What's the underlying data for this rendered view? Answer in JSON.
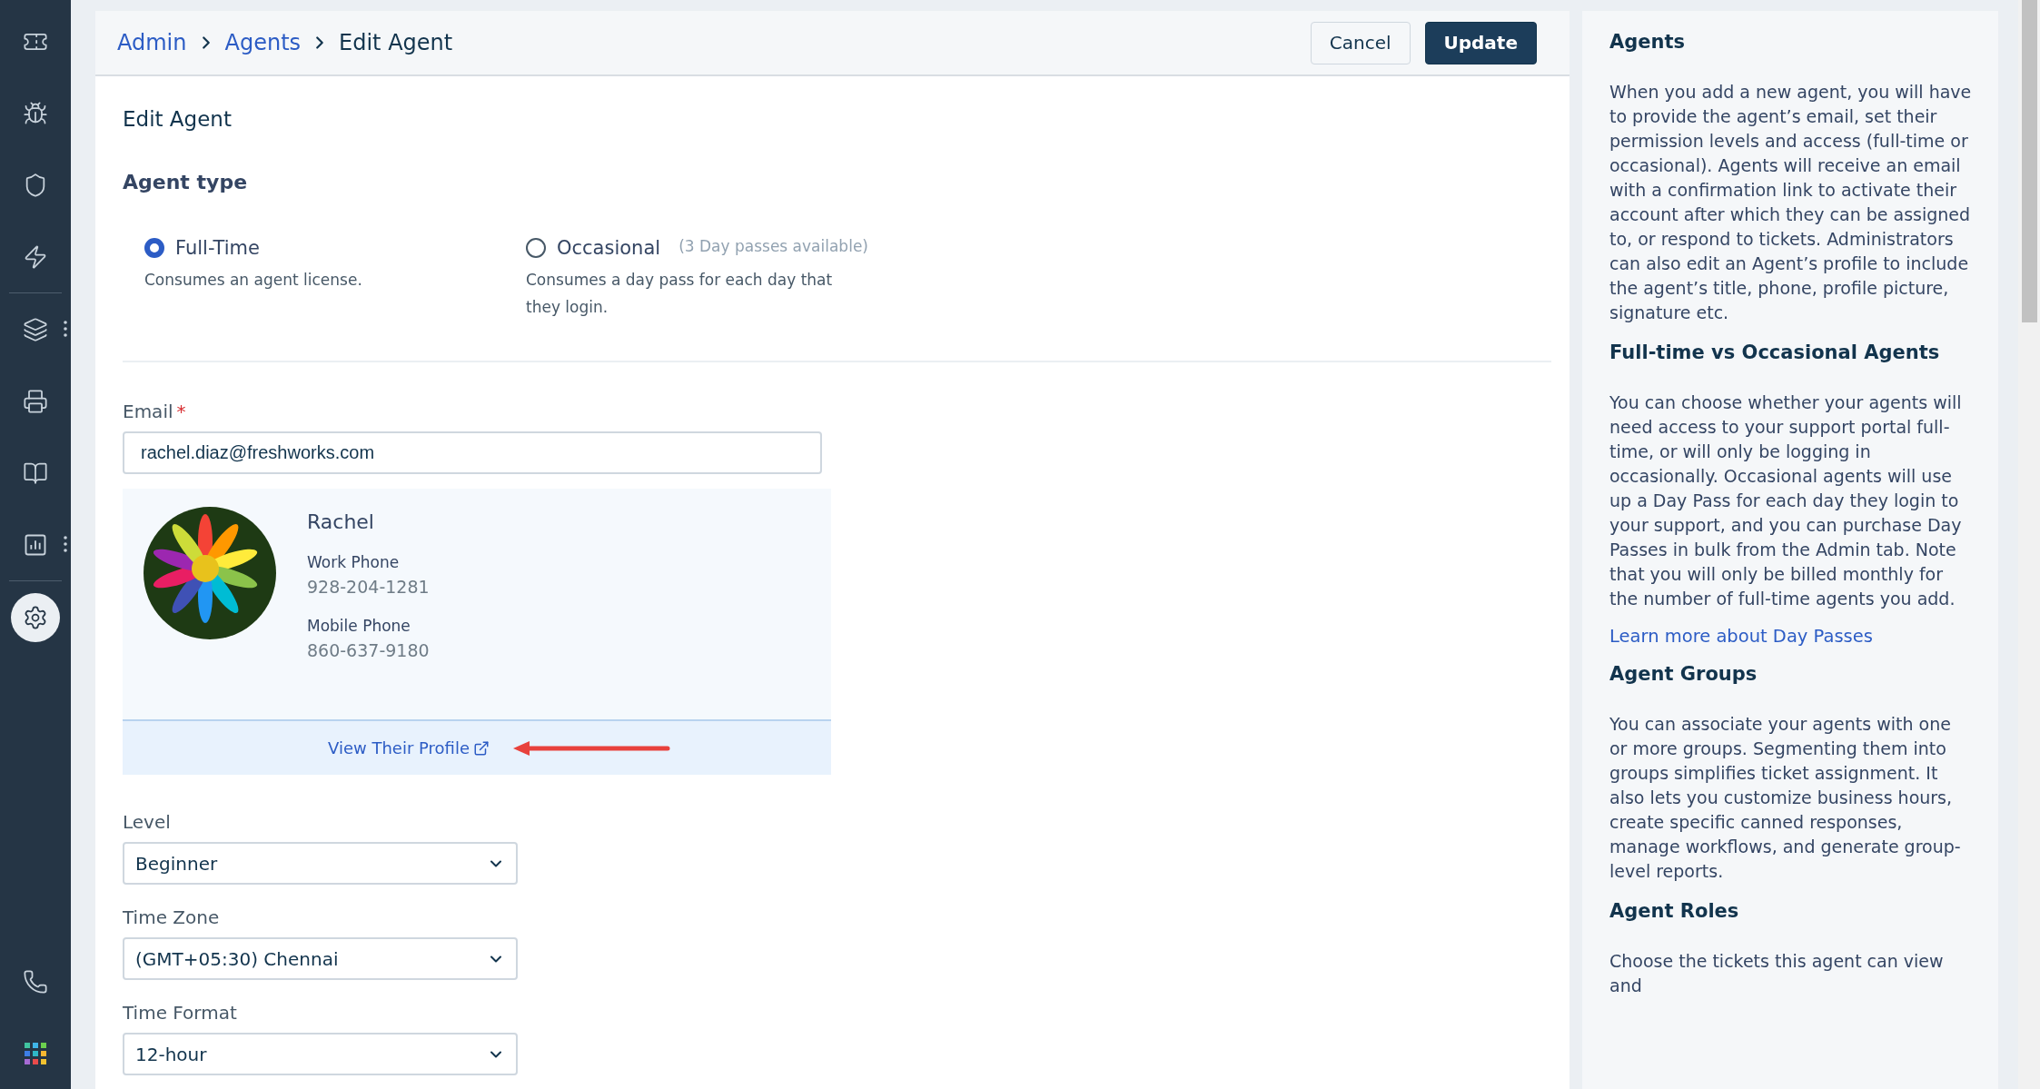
{
  "sidebar": {
    "items": [
      {
        "selected": false,
        "more": false
      },
      {
        "selected": false,
        "more": false
      },
      {
        "selected": false,
        "more": false
      },
      {
        "selected": false,
        "more": false
      },
      {
        "selected": false,
        "more": true
      },
      {
        "selected": false,
        "more": false
      },
      {
        "selected": false,
        "more": false
      },
      {
        "selected": false,
        "more": true
      },
      {
        "selected": true,
        "more": false
      }
    ]
  },
  "breadcrumb": [
    {
      "label": "Admin",
      "kind": "link"
    },
    {
      "label": "Agents",
      "kind": "link"
    },
    {
      "label": "Edit Agent",
      "kind": "current"
    }
  ],
  "actions": [
    {
      "label": "Cancel",
      "kind": "secondary"
    },
    {
      "label": "Update",
      "kind": "primary"
    }
  ],
  "form": {
    "title": "Edit Agent",
    "agent_type": {
      "label": "Agent type",
      "options": [
        {
          "label": "Full-Time",
          "description": "Consumes an agent license.",
          "selected": true
        },
        {
          "label": "Occasional",
          "hint": "(3 Day passes available)",
          "description": "Consumes a day pass for each day that they login.",
          "selected": false
        }
      ]
    },
    "email": {
      "label": "Email",
      "required_mark": "*",
      "value": "rachel.diaz@freshworks.com"
    },
    "profile": {
      "name": "Rachel",
      "fields": [
        {
          "label": "Work Phone",
          "value": "928-204-1281"
        },
        {
          "label": "Mobile Phone",
          "value": "860-637-9180"
        }
      ],
      "link": "View Their Profile"
    },
    "selects": [
      {
        "label": "Level",
        "value": "Beginner"
      },
      {
        "label": "Time Zone",
        "value": "(GMT+05:30) Chennai"
      },
      {
        "label": "Time Format",
        "value": "12-hour"
      }
    ]
  },
  "help": {
    "sections": [
      {
        "heading": "Agents",
        "text": "When you add a new agent, you will have to provide the agent’s email, set their permission levels and access (full-time or occasional). Agents will receive an email with a confirmation link to activate their account after which they can be assigned to, or respond to tickets. Administrators can also edit an Agent’s profile to include the agent’s title, phone, profile picture, signature etc."
      },
      {
        "heading": "Full-time vs Occasional Agents",
        "text": "You can choose whether your agents will need access to your support portal full-time, or will only be logging in occasionally. Occasional agents will use up a Day Pass for each day they login to your support, and you can purchase Day Passes in bulk from the Admin tab. Note that you will only be billed monthly for the number of full-time agents you add.",
        "link": "Learn more about Day Passes"
      },
      {
        "heading": "Agent Groups",
        "text": "You can associate your agents with one or more groups. Segmenting them into groups simplifies ticket assignment. It also lets you customize business hours, create specific canned responses, manage workflows, and generate group-level reports."
      },
      {
        "heading": "Agent Roles",
        "text": "Choose the tickets this agent can view and"
      }
    ]
  }
}
